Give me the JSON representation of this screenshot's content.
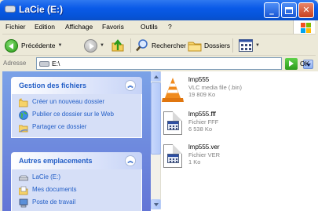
{
  "window": {
    "title": "LaCie (E:)",
    "buttons": {
      "minimize": "_",
      "close": "✕"
    }
  },
  "menubar": {
    "items": [
      "Fichier",
      "Edition",
      "Affichage",
      "Favoris",
      "Outils",
      "?"
    ]
  },
  "toolbar": {
    "back_label": "Précédente",
    "search_label": "Rechercher",
    "folders_label": "Dossiers"
  },
  "addressbar": {
    "label": "Adresse",
    "value": "E:\\",
    "go_label": "OK"
  },
  "tasks_panel": {
    "title": "Gestion des fichiers",
    "items": [
      {
        "label": "Créer un nouveau dossier",
        "icon": "new-folder-icon"
      },
      {
        "label": "Publier ce dossier sur le Web",
        "icon": "globe-icon"
      },
      {
        "label": "Partager ce dossier",
        "icon": "share-folder-icon"
      }
    ]
  },
  "places_panel": {
    "title": "Autres emplacements",
    "items": [
      {
        "label": "LaCie (E:)",
        "icon": "drive-icon"
      },
      {
        "label": "Mes documents",
        "icon": "documents-folder-icon"
      },
      {
        "label": "Poste de travail",
        "icon": "computer-icon"
      }
    ]
  },
  "files": [
    {
      "name": "lmp555",
      "type": "VLC media file (.bin)",
      "size": "19 809 Ko",
      "icon": "vlc-cone-icon"
    },
    {
      "name": "lmp555.fff",
      "type": "Fichier FFF",
      "size": "6 538 Ko",
      "icon": "generic-file-icon"
    },
    {
      "name": "lmp555.ver",
      "type": "Fichier VER",
      "size": "1 Ko",
      "icon": "generic-file-icon"
    }
  ],
  "colors": {
    "titlebar": "#0a5ae8",
    "taskpane_bg": "#6f8fdf",
    "task_link": "#215dc6",
    "window_bg": "#ece9d8"
  }
}
